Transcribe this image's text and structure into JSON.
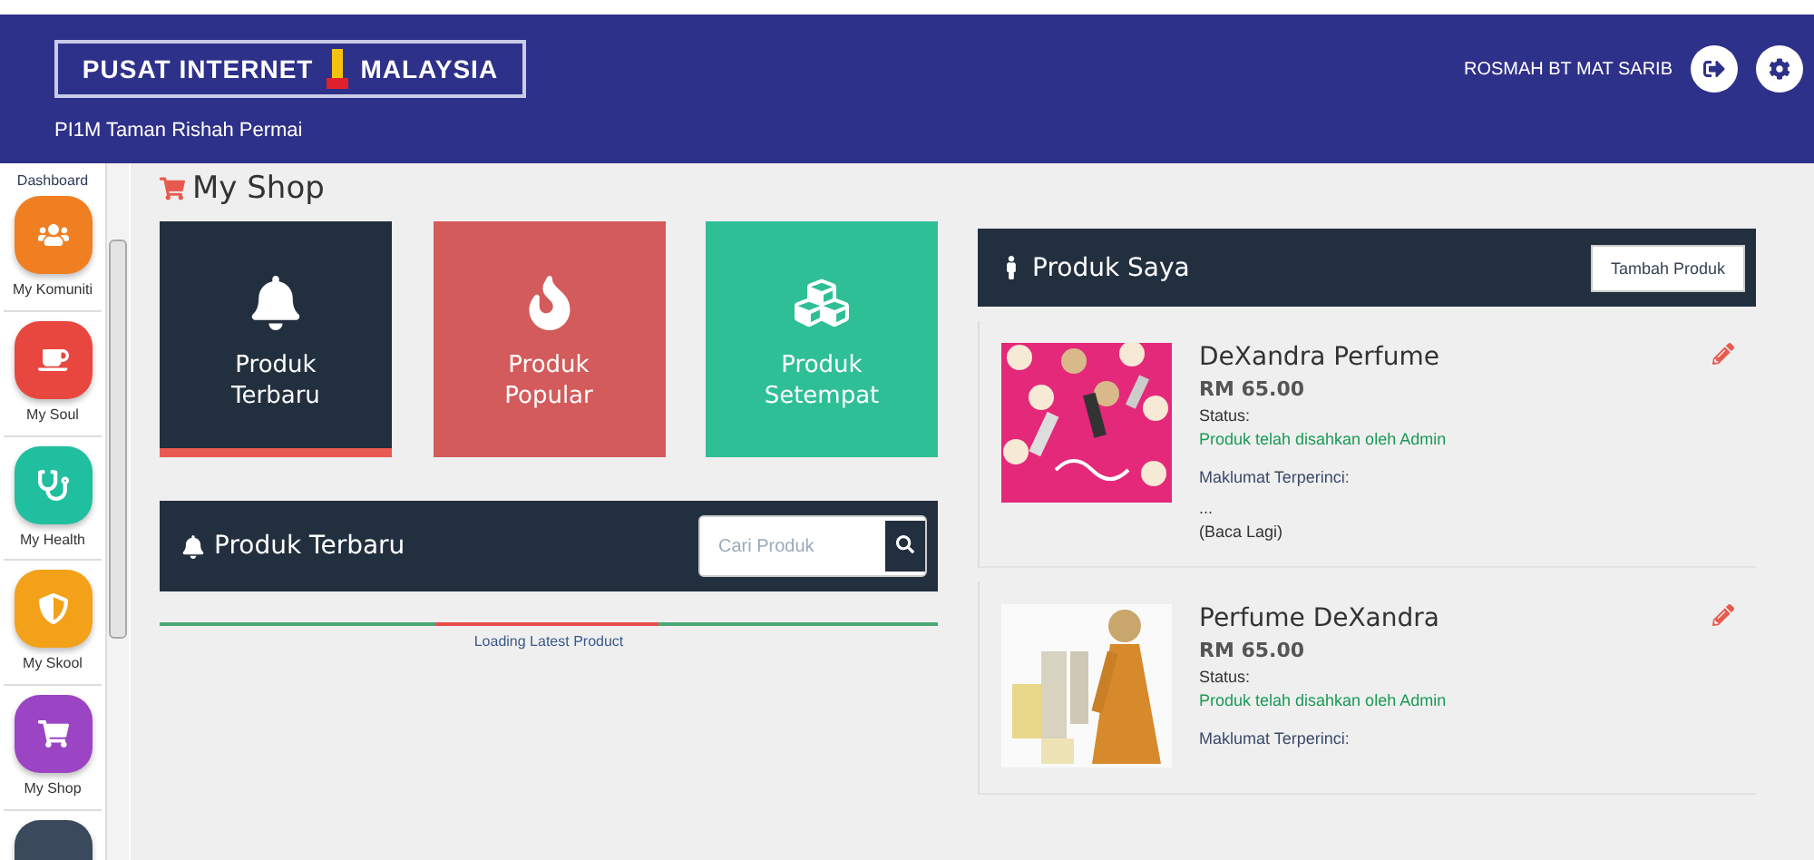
{
  "header": {
    "logo": {
      "left": "PUSAT INTERNET",
      "right": "MALAYSIA"
    },
    "subtitle": "PI1M Taman Rishah Permai",
    "user": "ROSMAH BT MAT SARIB"
  },
  "sidebar": {
    "title": "Dashboard",
    "items": [
      {
        "label": "My Komuniti",
        "color": "#f07f22"
      },
      {
        "label": "My Soul",
        "color": "#e8473f"
      },
      {
        "label": "My Health",
        "color": "#1fbf9f"
      },
      {
        "label": "My Skool",
        "color": "#f4a11a"
      },
      {
        "label": "My Shop",
        "color": "#9b44c4"
      },
      {
        "color": "#3a4a5c"
      }
    ]
  },
  "page_title": "My Shop",
  "tiles": [
    {
      "label": "Produk Terbaru",
      "color": "#222f3f",
      "selected": true
    },
    {
      "label": "Produk Popular",
      "color": "#d45b5b",
      "selected": false
    },
    {
      "label": "Produk Setempat",
      "color": "#2fbf96",
      "selected": false
    }
  ],
  "latest": {
    "title": "Produk Terbaru",
    "search": {
      "placeholder": "Cari Produk"
    },
    "loading": "Loading Latest Product"
  },
  "my_products": {
    "title": "Produk Saya",
    "add_button": "Tambah Produk",
    "items": [
      {
        "name": "DeXandra Perfume",
        "price": "RM 65.00",
        "status_label": "Status:",
        "status": "Produk telah disahkan oleh Admin",
        "detail_label": "Maklumat Terperinci:",
        "detail": "...",
        "more": "(Baca Lagi)"
      },
      {
        "name": "Perfume DeXandra",
        "price": "RM 65.00",
        "status_label": "Status:",
        "status": "Produk telah disahkan oleh Admin",
        "detail_label": "Maklumat Terperinci:"
      }
    ]
  }
}
